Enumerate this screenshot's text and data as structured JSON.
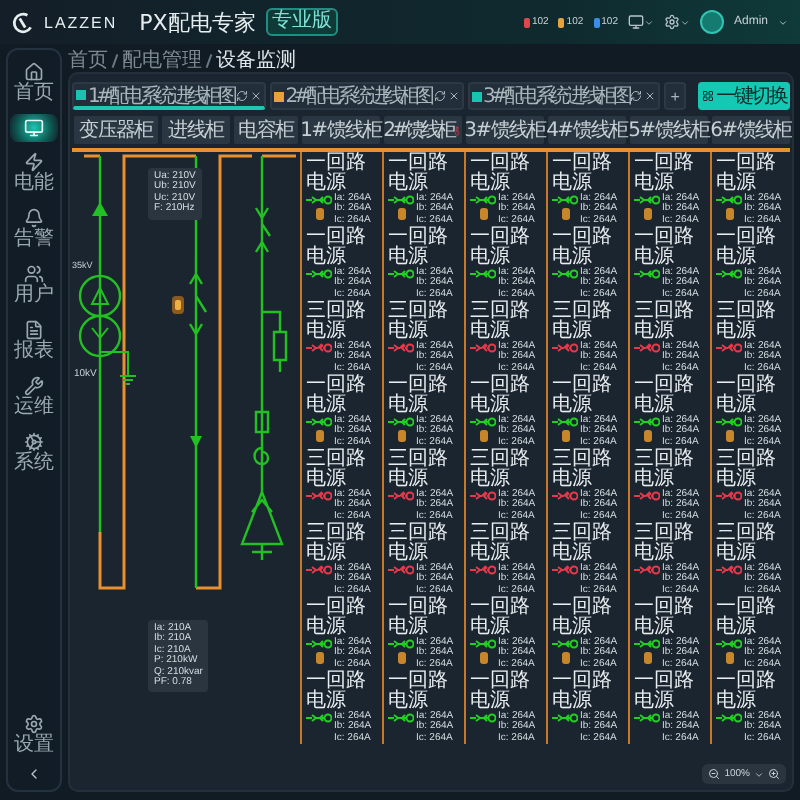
{
  "header": {
    "brand": "LAZZEN",
    "product": "PX配电专家",
    "edition": "专业版",
    "alerts": [
      {
        "count": "102",
        "color": "#e0474c"
      },
      {
        "count": "102",
        "color": "#e6a23c"
      },
      {
        "count": "102",
        "color": "#3a8ee6"
      }
    ],
    "user": "Admin"
  },
  "sidebar": {
    "items": [
      {
        "label": "首页",
        "selected": false
      },
      {
        "selected": true
      },
      {
        "label": "电能",
        "selected": false
      },
      {
        "label": "告警",
        "selected": false
      },
      {
        "label": "用户",
        "selected": false
      },
      {
        "label": "报表",
        "selected": false
      },
      {
        "label": "运维",
        "selected": false
      },
      {
        "label": "系统",
        "selected": false
      }
    ],
    "bottom": [
      {
        "label": "设置",
        "selected": false
      }
    ]
  },
  "breadcrumb": [
    "首页",
    "配电管理",
    "设备监测"
  ],
  "tabs": [
    {
      "label": "1#配电系统进线柜图",
      "selected": true,
      "color": "#18c4b0"
    },
    {
      "label": "2#配电系统进线柜图",
      "selected": false,
      "color": "#e6a23c"
    },
    {
      "label": "3#配电系统进线柜图",
      "selected": false,
      "color": "#18c4b0"
    }
  ],
  "add_tab": "+",
  "action_button": "一键切换",
  "columns": [
    {
      "label": "变压器柜",
      "alert": false
    },
    {
      "label": "进线柜",
      "alert": false
    },
    {
      "label": "电容柜",
      "alert": false
    },
    {
      "label": "1#馈线柜",
      "alert": false
    },
    {
      "label": "2#馈线柜",
      "alert": true
    },
    {
      "label": "3#馈线柜",
      "alert": false
    },
    {
      "label": "4#馈线柜",
      "alert": false
    },
    {
      "label": "5#馈线柜",
      "alert": false
    },
    {
      "label": "6#馈线柜",
      "alert": false
    }
  ],
  "diagram": {
    "transformer_labels": [
      "35kV",
      "10kV"
    ],
    "voltage": [
      "Ua: 210V",
      "Ub: 210V",
      "Uc: 210V",
      "F: 210Hz"
    ],
    "power": [
      "Ia: 210A",
      "Ib: 210A",
      "Ic: 210A",
      "P: 210kW",
      "Q: 210kvar",
      "PF: 0.78"
    ]
  },
  "feeder_rows": [
    {
      "cells": [
        {
          "label": "一回路电源",
          "kind": "closed",
          "alarm": true,
          "readings": [
            "Ia: 264A",
            "Ib: 264A",
            "Ic: 264A"
          ]
        },
        {
          "label": "一回路电源",
          "kind": "closed",
          "alarm": true,
          "readings": [
            "Ia: 264A",
            "Ib: 264A",
            "Ic: 264A"
          ]
        },
        {
          "label": "一回路电源",
          "kind": "closed",
          "alarm": true,
          "readings": [
            "Ia: 264A",
            "Ib: 264A",
            "Ic: 264A"
          ]
        },
        {
          "label": "一回路电源",
          "kind": "closed",
          "alarm": true,
          "readings": [
            "Ia: 264A",
            "Ib: 264A",
            "Ic: 264A"
          ]
        },
        {
          "label": "一回路电源",
          "kind": "closed",
          "alarm": true,
          "readings": [
            "Ia: 264A",
            "Ib: 264A",
            "Ic: 264A"
          ]
        },
        {
          "label": "一回路电源",
          "kind": "closed",
          "alarm": true,
          "readings": [
            "Ia: 264A",
            "Ib: 264A",
            "Ic: 264A"
          ]
        }
      ]
    },
    {
      "cells": [
        {
          "label": "一回路电源",
          "kind": "closed",
          "alarm": false,
          "readings": [
            "Ia: 264A",
            "Ib: 264A",
            "Ic: 264A"
          ]
        },
        {
          "label": "一回路电源",
          "kind": "closed",
          "alarm": false,
          "readings": [
            "Ia: 264A",
            "Ib: 264A",
            "Ic: 264A"
          ]
        },
        {
          "label": "一回路电源",
          "kind": "closed",
          "alarm": false,
          "readings": [
            "Ia: 264A",
            "Ib: 264A",
            "Ic: 264A"
          ]
        },
        {
          "label": "一回路电源",
          "kind": "closed",
          "alarm": false,
          "readings": [
            "Ia: 264A",
            "Ib: 264A",
            "Ic: 264A"
          ]
        },
        {
          "label": "一回路电源",
          "kind": "closed",
          "alarm": false,
          "readings": [
            "Ia: 264A",
            "Ib: 264A",
            "Ic: 264A"
          ]
        },
        {
          "label": "一回路电源",
          "kind": "closed",
          "alarm": false,
          "readings": [
            "Ia: 264A",
            "Ib: 264A",
            "Ic: 264A"
          ]
        }
      ]
    },
    {
      "cells": [
        {
          "label": "三回路电源",
          "kind": "open",
          "alarm": false,
          "readings": [
            "Ia: 264A",
            "Ib: 264A",
            "Ic: 264A"
          ]
        },
        {
          "label": "三回路电源",
          "kind": "open",
          "alarm": false,
          "readings": [
            "Ia: 264A",
            "Ib: 264A",
            "Ic: 264A"
          ]
        },
        {
          "label": "三回路电源",
          "kind": "open",
          "alarm": false,
          "readings": [
            "Ia: 264A",
            "Ib: 264A",
            "Ic: 264A"
          ]
        },
        {
          "label": "三回路电源",
          "kind": "open",
          "alarm": false,
          "readings": [
            "Ia: 264A",
            "Ib: 264A",
            "Ic: 264A"
          ]
        },
        {
          "label": "三回路电源",
          "kind": "open",
          "alarm": false,
          "readings": [
            "Ia: 264A",
            "Ib: 264A",
            "Ic: 264A"
          ]
        },
        {
          "label": "三回路电源",
          "kind": "open",
          "alarm": false,
          "readings": [
            "Ia: 264A",
            "Ib: 264A",
            "Ic: 264A"
          ]
        }
      ]
    },
    {
      "cells": [
        {
          "label": "一回路电源",
          "kind": "closed",
          "alarm": true,
          "readings": [
            "Ia: 264A",
            "Ib: 264A",
            "Ic: 264A"
          ]
        },
        {
          "label": "一回路电源",
          "kind": "closed",
          "alarm": true,
          "readings": [
            "Ia: 264A",
            "Ib: 264A",
            "Ic: 264A"
          ]
        },
        {
          "label": "一回路电源",
          "kind": "closed",
          "alarm": true,
          "readings": [
            "Ia: 264A",
            "Ib: 264A",
            "Ic: 264A"
          ]
        },
        {
          "label": "一回路电源",
          "kind": "closed",
          "alarm": true,
          "readings": [
            "Ia: 264A",
            "Ib: 264A",
            "Ic: 264A"
          ]
        },
        {
          "label": "一回路电源",
          "kind": "closed",
          "alarm": true,
          "readings": [
            "Ia: 264A",
            "Ib: 264A",
            "Ic: 264A"
          ]
        },
        {
          "label": "一回路电源",
          "kind": "closed",
          "alarm": true,
          "readings": [
            "Ia: 264A",
            "Ib: 264A",
            "Ic: 264A"
          ]
        }
      ]
    },
    {
      "cells": [
        {
          "label": "三回路电源",
          "kind": "open",
          "alarm": false,
          "readings": [
            "Ia: 264A",
            "Ib: 264A",
            "Ic: 264A"
          ]
        },
        {
          "label": "三回路电源",
          "kind": "open",
          "alarm": false,
          "readings": [
            "Ia: 264A",
            "Ib: 264A",
            "Ic: 264A"
          ]
        },
        {
          "label": "三回路电源",
          "kind": "open",
          "alarm": false,
          "readings": [
            "Ia: 264A",
            "Ib: 264A",
            "Ic: 264A"
          ]
        },
        {
          "label": "三回路电源",
          "kind": "open",
          "alarm": false,
          "readings": [
            "Ia: 264A",
            "Ib: 264A",
            "Ic: 264A"
          ]
        },
        {
          "label": "三回路电源",
          "kind": "open",
          "alarm": false,
          "readings": [
            "Ia: 264A",
            "Ib: 264A",
            "Ic: 264A"
          ]
        },
        {
          "label": "三回路电源",
          "kind": "open",
          "alarm": false,
          "readings": [
            "Ia: 264A",
            "Ib: 264A",
            "Ic: 264A"
          ]
        }
      ]
    },
    {
      "cells": [
        {
          "label": "三回路电源",
          "kind": "open",
          "alarm": false,
          "readings": [
            "Ia: 264A",
            "Ib: 264A",
            "Ic: 264A"
          ]
        },
        {
          "label": "三回路电源",
          "kind": "open",
          "alarm": false,
          "readings": [
            "Ia: 264A",
            "Ib: 264A",
            "Ic: 264A"
          ]
        },
        {
          "label": "三回路电源",
          "kind": "open",
          "alarm": false,
          "readings": [
            "Ia: 264A",
            "Ib: 264A",
            "Ic: 264A"
          ]
        },
        {
          "label": "三回路电源",
          "kind": "open",
          "alarm": false,
          "readings": [
            "Ia: 264A",
            "Ib: 264A",
            "Ic: 264A"
          ]
        },
        {
          "label": "三回路电源",
          "kind": "open",
          "alarm": false,
          "readings": [
            "Ia: 264A",
            "Ib: 264A",
            "Ic: 264A"
          ]
        },
        {
          "label": "三回路电源",
          "kind": "open",
          "alarm": false,
          "readings": [
            "Ia: 264A",
            "Ib: 264A",
            "Ic: 264A"
          ]
        }
      ]
    },
    {
      "cells": [
        {
          "label": "一回路电源",
          "kind": "closed",
          "alarm": true,
          "readings": [
            "Ia: 264A",
            "Ib: 264A",
            "Ic: 264A"
          ]
        },
        {
          "label": "一回路电源",
          "kind": "closed",
          "alarm": true,
          "readings": [
            "Ia: 264A",
            "Ib: 264A",
            "Ic: 264A"
          ]
        },
        {
          "label": "一回路电源",
          "kind": "closed",
          "alarm": true,
          "readings": [
            "Ia: 264A",
            "Ib: 264A",
            "Ic: 264A"
          ]
        },
        {
          "label": "一回路电源",
          "kind": "closed",
          "alarm": true,
          "readings": [
            "Ia: 264A",
            "Ib: 264A",
            "Ic: 264A"
          ]
        },
        {
          "label": "一回路电源",
          "kind": "closed",
          "alarm": true,
          "readings": [
            "Ia: 264A",
            "Ib: 264A",
            "Ic: 264A"
          ]
        },
        {
          "label": "一回路电源",
          "kind": "closed",
          "alarm": true,
          "readings": [
            "Ia: 264A",
            "Ib: 264A",
            "Ic: 264A"
          ]
        }
      ]
    },
    {
      "cells": [
        {
          "label": "一回路电源",
          "kind": "closed",
          "alarm": false,
          "readings": [
            "Ia: 264A",
            "Ib: 264A",
            "Ic: 264A"
          ]
        },
        {
          "label": "一回路电源",
          "kind": "closed",
          "alarm": false,
          "readings": [
            "Ia: 264A",
            "Ib: 264A",
            "Ic: 264A"
          ]
        },
        {
          "label": "一回路电源",
          "kind": "closed",
          "alarm": false,
          "readings": [
            "Ia: 264A",
            "Ib: 264A",
            "Ic: 264A"
          ]
        },
        {
          "label": "一回路电源",
          "kind": "closed",
          "alarm": false,
          "readings": [
            "Ia: 264A",
            "Ib: 264A",
            "Ic: 264A"
          ]
        },
        {
          "label": "一回路电源",
          "kind": "closed",
          "alarm": false,
          "readings": [
            "Ia: 264A",
            "Ib: 264A",
            "Ic: 264A"
          ]
        },
        {
          "label": "一回路电源",
          "kind": "closed",
          "alarm": false,
          "readings": [
            "Ia: 264A",
            "Ib: 264A",
            "Ic: 264A"
          ]
        }
      ]
    }
  ],
  "zoom": "100%"
}
